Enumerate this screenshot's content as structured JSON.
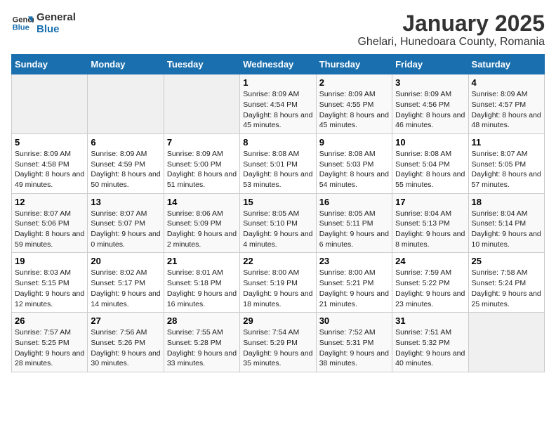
{
  "logo": {
    "line1": "General",
    "line2": "Blue"
  },
  "title": "January 2025",
  "subtitle": "Ghelari, Hunedoara County, Romania",
  "weekdays": [
    "Sunday",
    "Monday",
    "Tuesday",
    "Wednesday",
    "Thursday",
    "Friday",
    "Saturday"
  ],
  "weeks": [
    [
      {
        "day": "",
        "info": ""
      },
      {
        "day": "",
        "info": ""
      },
      {
        "day": "",
        "info": ""
      },
      {
        "day": "1",
        "info": "Sunrise: 8:09 AM\nSunset: 4:54 PM\nDaylight: 8 hours\nand 45 minutes."
      },
      {
        "day": "2",
        "info": "Sunrise: 8:09 AM\nSunset: 4:55 PM\nDaylight: 8 hours\nand 45 minutes."
      },
      {
        "day": "3",
        "info": "Sunrise: 8:09 AM\nSunset: 4:56 PM\nDaylight: 8 hours\nand 46 minutes."
      },
      {
        "day": "4",
        "info": "Sunrise: 8:09 AM\nSunset: 4:57 PM\nDaylight: 8 hours\nand 48 minutes."
      }
    ],
    [
      {
        "day": "5",
        "info": "Sunrise: 8:09 AM\nSunset: 4:58 PM\nDaylight: 8 hours\nand 49 minutes."
      },
      {
        "day": "6",
        "info": "Sunrise: 8:09 AM\nSunset: 4:59 PM\nDaylight: 8 hours\nand 50 minutes."
      },
      {
        "day": "7",
        "info": "Sunrise: 8:09 AM\nSunset: 5:00 PM\nDaylight: 8 hours\nand 51 minutes."
      },
      {
        "day": "8",
        "info": "Sunrise: 8:08 AM\nSunset: 5:01 PM\nDaylight: 8 hours\nand 53 minutes."
      },
      {
        "day": "9",
        "info": "Sunrise: 8:08 AM\nSunset: 5:03 PM\nDaylight: 8 hours\nand 54 minutes."
      },
      {
        "day": "10",
        "info": "Sunrise: 8:08 AM\nSunset: 5:04 PM\nDaylight: 8 hours\nand 55 minutes."
      },
      {
        "day": "11",
        "info": "Sunrise: 8:07 AM\nSunset: 5:05 PM\nDaylight: 8 hours\nand 57 minutes."
      }
    ],
    [
      {
        "day": "12",
        "info": "Sunrise: 8:07 AM\nSunset: 5:06 PM\nDaylight: 8 hours\nand 59 minutes."
      },
      {
        "day": "13",
        "info": "Sunrise: 8:07 AM\nSunset: 5:07 PM\nDaylight: 9 hours\nand 0 minutes."
      },
      {
        "day": "14",
        "info": "Sunrise: 8:06 AM\nSunset: 5:09 PM\nDaylight: 9 hours\nand 2 minutes."
      },
      {
        "day": "15",
        "info": "Sunrise: 8:05 AM\nSunset: 5:10 PM\nDaylight: 9 hours\nand 4 minutes."
      },
      {
        "day": "16",
        "info": "Sunrise: 8:05 AM\nSunset: 5:11 PM\nDaylight: 9 hours\nand 6 minutes."
      },
      {
        "day": "17",
        "info": "Sunrise: 8:04 AM\nSunset: 5:13 PM\nDaylight: 9 hours\nand 8 minutes."
      },
      {
        "day": "18",
        "info": "Sunrise: 8:04 AM\nSunset: 5:14 PM\nDaylight: 9 hours\nand 10 minutes."
      }
    ],
    [
      {
        "day": "19",
        "info": "Sunrise: 8:03 AM\nSunset: 5:15 PM\nDaylight: 9 hours\nand 12 minutes."
      },
      {
        "day": "20",
        "info": "Sunrise: 8:02 AM\nSunset: 5:17 PM\nDaylight: 9 hours\nand 14 minutes."
      },
      {
        "day": "21",
        "info": "Sunrise: 8:01 AM\nSunset: 5:18 PM\nDaylight: 9 hours\nand 16 minutes."
      },
      {
        "day": "22",
        "info": "Sunrise: 8:00 AM\nSunset: 5:19 PM\nDaylight: 9 hours\nand 18 minutes."
      },
      {
        "day": "23",
        "info": "Sunrise: 8:00 AM\nSunset: 5:21 PM\nDaylight: 9 hours\nand 21 minutes."
      },
      {
        "day": "24",
        "info": "Sunrise: 7:59 AM\nSunset: 5:22 PM\nDaylight: 9 hours\nand 23 minutes."
      },
      {
        "day": "25",
        "info": "Sunrise: 7:58 AM\nSunset: 5:24 PM\nDaylight: 9 hours\nand 25 minutes."
      }
    ],
    [
      {
        "day": "26",
        "info": "Sunrise: 7:57 AM\nSunset: 5:25 PM\nDaylight: 9 hours\nand 28 minutes."
      },
      {
        "day": "27",
        "info": "Sunrise: 7:56 AM\nSunset: 5:26 PM\nDaylight: 9 hours\nand 30 minutes."
      },
      {
        "day": "28",
        "info": "Sunrise: 7:55 AM\nSunset: 5:28 PM\nDaylight: 9 hours\nand 33 minutes."
      },
      {
        "day": "29",
        "info": "Sunrise: 7:54 AM\nSunset: 5:29 PM\nDaylight: 9 hours\nand 35 minutes."
      },
      {
        "day": "30",
        "info": "Sunrise: 7:52 AM\nSunset: 5:31 PM\nDaylight: 9 hours\nand 38 minutes."
      },
      {
        "day": "31",
        "info": "Sunrise: 7:51 AM\nSunset: 5:32 PM\nDaylight: 9 hours\nand 40 minutes."
      },
      {
        "day": "",
        "info": ""
      }
    ]
  ]
}
